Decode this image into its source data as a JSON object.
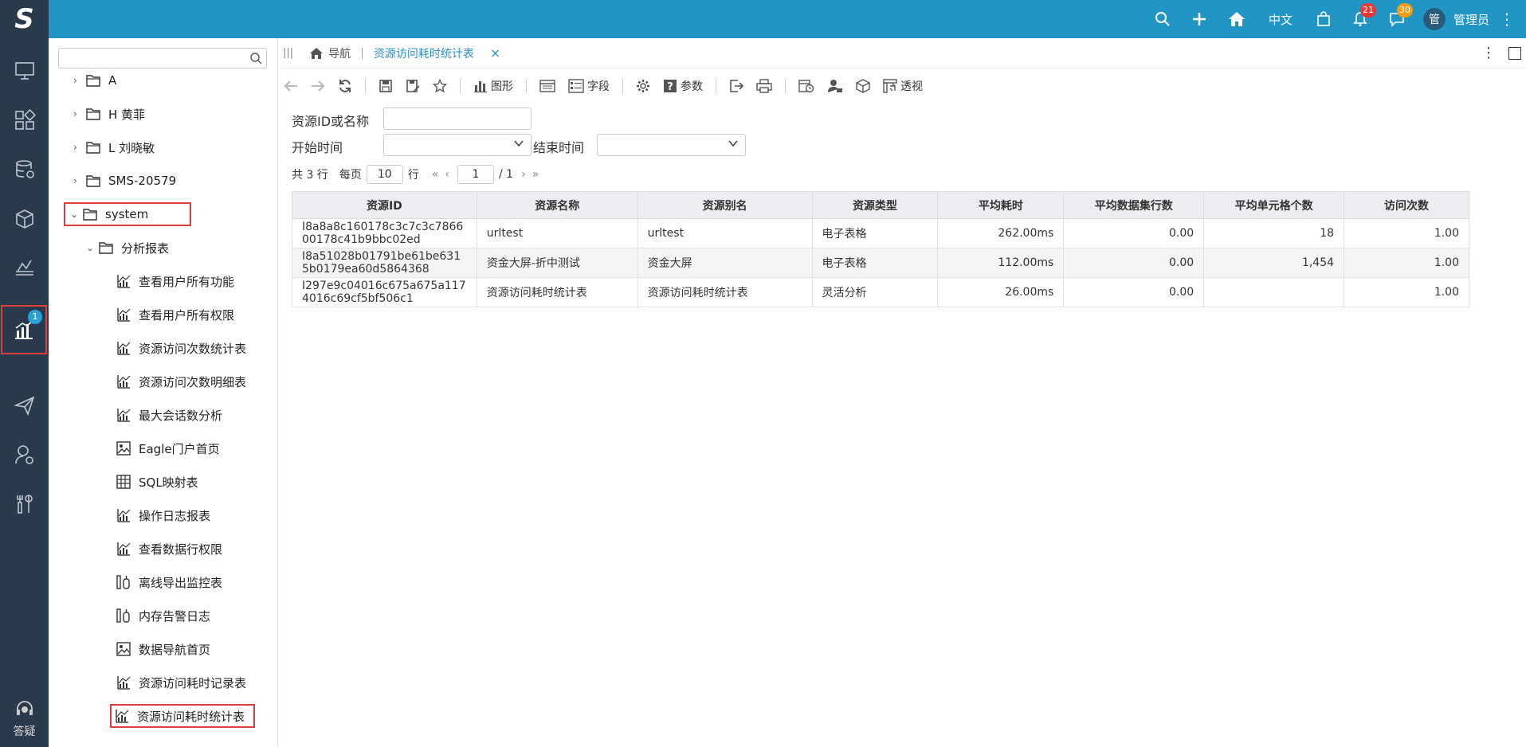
{
  "topbar": {
    "lang": "中文",
    "bell_count": "21",
    "msg_count": "30",
    "avatar_text": "管",
    "user_name": "管理员"
  },
  "leftnav": {
    "analysis_badge": "1",
    "help_label": "答疑"
  },
  "tree": {
    "search_placeholder": "",
    "nodes": [
      "A",
      "H 黄菲",
      "L 刘晓敏",
      "SMS-20579",
      "system",
      "分析报表",
      "查看用户所有功能",
      "查看用户所有权限",
      "资源访问次数统计表",
      "资源访问次数明细表",
      "最大会话数分析",
      "Eagle门户首页",
      "SQL映射表",
      "操作日志报表",
      "查看数据行权限",
      "离线导出监控表",
      "内存告警日志",
      "数据导航首页",
      "资源访问耗时记录表",
      "资源访问耗时统计表"
    ]
  },
  "tabs": {
    "home": "导航",
    "current": "资源访问耗时统计表"
  },
  "toolbar": {
    "chart": "图形",
    "fields": "字段",
    "params": "参数",
    "pivot": "透视"
  },
  "query": {
    "resource_label": "资源ID或名称",
    "resource_value": "",
    "start_label": "开始时间",
    "start_value": "",
    "end_label": "结束时间",
    "end_value": ""
  },
  "pager": {
    "total": "共 3 行",
    "per_page_label": "每页",
    "per_page": "10",
    "row_unit": "行",
    "page": "1",
    "total_pages": "/ 1"
  },
  "table": {
    "headers": [
      "资源ID",
      "资源名称",
      "资源别名",
      "资源类型",
      "平均耗时",
      "平均数据集行数",
      "平均单元格个数",
      "访问次数"
    ],
    "rows": [
      [
        "I8a8a8c160178c3c7c3c786600178c41b9bbc02ed",
        "urltest",
        "urltest",
        "电子表格",
        "262.00ms",
        "0.00",
        "18",
        "1.00"
      ],
      [
        "I8a51028b01791be61be6315b0179ea60d5864368",
        "资金大屏-折中测试",
        "资金大屏",
        "电子表格",
        "112.00ms",
        "0.00",
        "1,454",
        "1.00"
      ],
      [
        "I297e9c04016c675a675a1174016c69cf5bf506c1",
        "资源访问耗时统计表",
        "资源访问耗时统计表",
        "灵活分析",
        "26.00ms",
        "0.00",
        "",
        "1.00"
      ]
    ]
  }
}
